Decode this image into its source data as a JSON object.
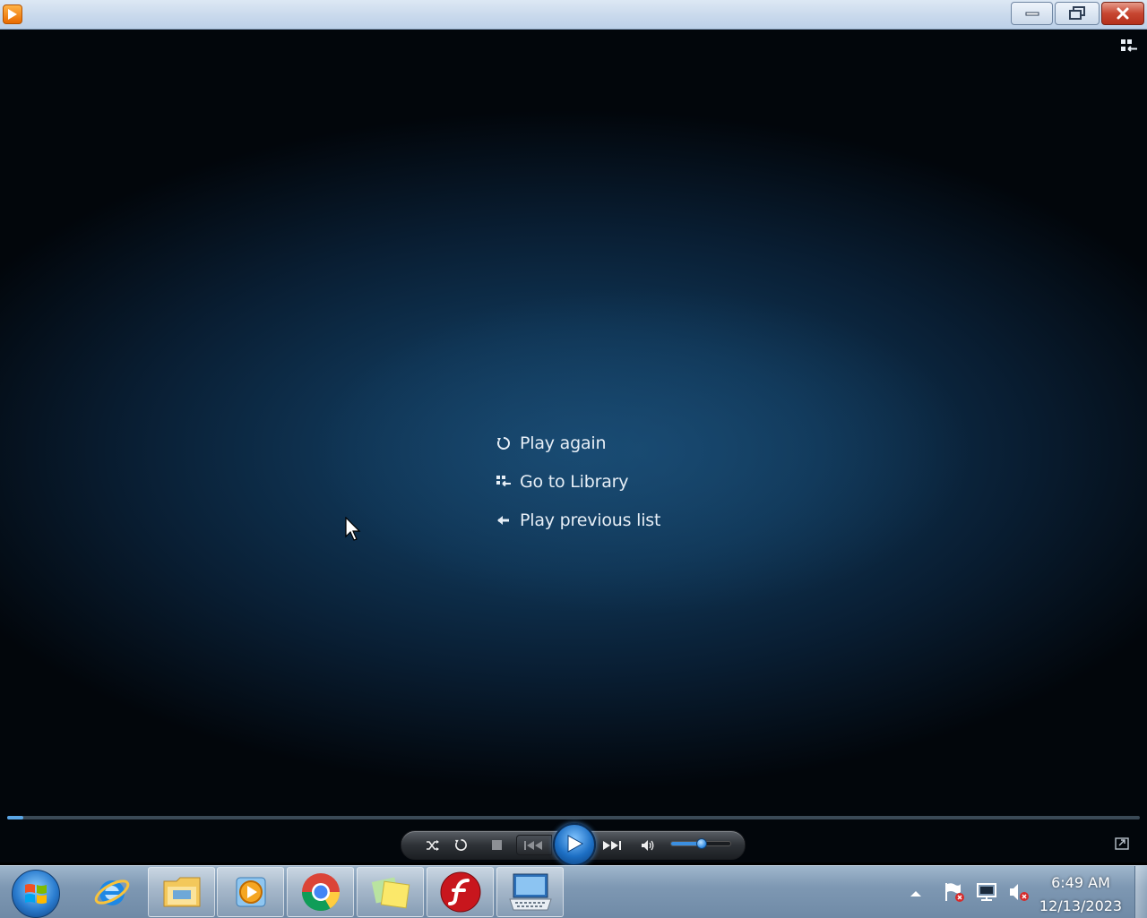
{
  "window": {
    "app_icon": "media-player-icon",
    "buttons": {
      "minimize": "minimize-icon",
      "restore": "restore-icon",
      "close": "close-icon"
    }
  },
  "player": {
    "switch_to_library_icon": "switch-to-library-icon",
    "menu": [
      {
        "label": "Play again",
        "icon": "replay-icon"
      },
      {
        "label": "Go to Library",
        "icon": "library-icon"
      },
      {
        "label": "Play previous list",
        "icon": "back-arrow-icon"
      }
    ],
    "seek_progress": 0.014,
    "controls": [
      "shuffle-icon",
      "repeat-icon",
      "stop-icon",
      "previous-icon",
      "play-icon",
      "next-icon",
      "volume-icon"
    ],
    "volume_level": 0.5
  },
  "taskbar": {
    "pinned": [
      "internet-explorer-icon",
      "windows-explorer-icon",
      "media-player-icon",
      "chrome-icon",
      "sticky-notes-icon",
      "flash-icon",
      "on-screen-keyboard-icon"
    ],
    "tray": [
      "show-hidden-icons",
      "action-center-flag-icon",
      "network-icon",
      "volume-muted-icon"
    ],
    "clock": {
      "time": "6:49 AM",
      "date": "12/13/2023"
    }
  },
  "colors": {
    "accent": "#3b8fe0",
    "background_center": "#17456b",
    "taskbar": "#7e98b3"
  }
}
